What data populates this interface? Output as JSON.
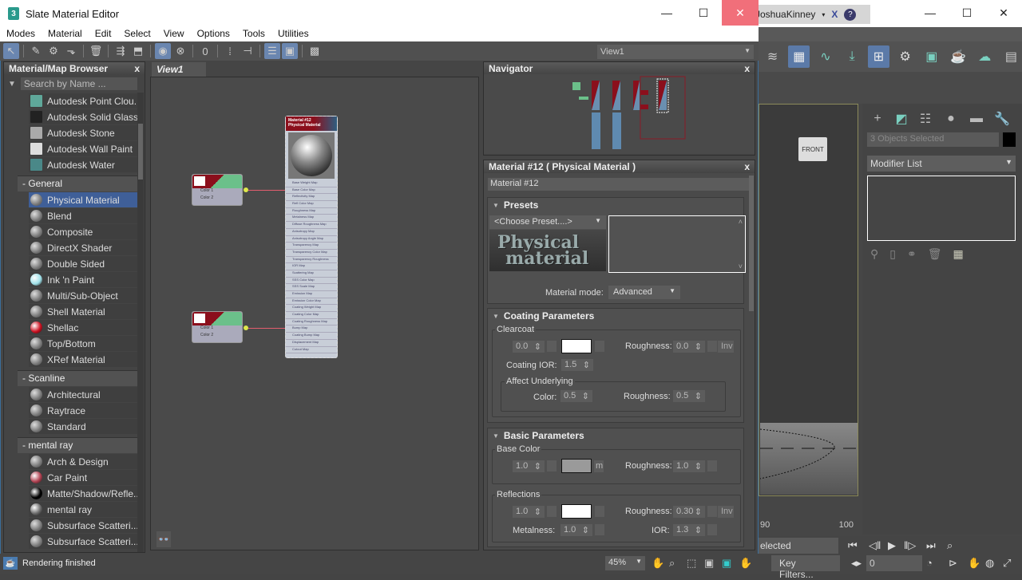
{
  "background_app": {
    "user": "JoshuaKinney",
    "window_controls": [
      "minimize",
      "maximize",
      "close"
    ],
    "viewport_label": "FRONT",
    "command_panel": {
      "objects_selected": "3 Objects Selected",
      "modifier_list": "Modifier List",
      "tabs": [
        "create",
        "modify",
        "hierarchy",
        "motion",
        "display",
        "utilities"
      ]
    },
    "timeline": {
      "ticks": [
        "90",
        "100"
      ]
    },
    "selection_filter": "elected",
    "key_filters": "Key Filters...",
    "frame": "0"
  },
  "sme": {
    "title": "Slate Material Editor",
    "menu": [
      "Modes",
      "Material",
      "Edit",
      "Select",
      "View",
      "Options",
      "Tools",
      "Utilities"
    ],
    "view_select": "View1",
    "browser": {
      "title": "Material/Map Browser",
      "close": "x",
      "search_placeholder": "Search by Name ...",
      "autodesk_items": [
        {
          "label": "Autodesk Point Clou...",
          "swatch": "#5fa89a"
        },
        {
          "label": "Autodesk Solid Glass",
          "swatch": "#222"
        },
        {
          "label": "Autodesk Stone",
          "swatch": "#aaa"
        },
        {
          "label": "Autodesk Wall Paint",
          "swatch": "#ddd"
        },
        {
          "label": "Autodesk Water",
          "swatch": "#4a8888"
        }
      ],
      "groups": [
        {
          "label": "- General",
          "items": [
            {
              "label": "Physical Material",
              "selected": true
            },
            {
              "label": "Blend"
            },
            {
              "label": "Composite"
            },
            {
              "label": "DirectX Shader"
            },
            {
              "label": "Double Sided"
            },
            {
              "label": "Ink 'n Paint",
              "swatch": "#9fe0e8"
            },
            {
              "label": "Multi/Sub-Object"
            },
            {
              "label": "Shell Material"
            },
            {
              "label": "Shellac",
              "swatch": "#cc1020"
            },
            {
              "label": "Top/Bottom"
            },
            {
              "label": "XRef Material"
            }
          ]
        },
        {
          "label": "- Scanline",
          "items": [
            {
              "label": "Architectural"
            },
            {
              "label": "Raytrace"
            },
            {
              "label": "Standard"
            }
          ]
        },
        {
          "label": "- mental ray",
          "items": [
            {
              "label": "Arch & Design"
            },
            {
              "label": "Car Paint",
              "swatch": "#b04050"
            },
            {
              "label": "Matte/Shadow/Refle...",
              "swatch": "#000"
            },
            {
              "label": "mental ray",
              "swatch": "#6a6a6a"
            },
            {
              "label": "Subsurface Scatteri..."
            },
            {
              "label": "Subsurface Scatteri..."
            }
          ]
        }
      ]
    },
    "view": {
      "tab": "View1",
      "small_nodes": [
        {
          "slots": [
            "Color 1",
            "Color 2"
          ]
        },
        {
          "slots": [
            "Color 1",
            "Color 2"
          ]
        }
      ],
      "material_node": {
        "title": "Material #12",
        "subtitle": "Physical Material",
        "slots": [
          "Base Weight Map",
          "Base Color Map",
          "Reflectivity Map",
          "Refl Color Map",
          "Roughness Map",
          "Metalness Map",
          "Diffuse Roughness Map",
          "Anisotropy Map",
          "Anisotropy Angle Map",
          "Transparency Map",
          "Transparency Color Map",
          "Transparency Roughness",
          "IOR Map",
          "Scattering Map",
          "SSS Color Map",
          "SSS Scale Map",
          "Emission Map",
          "Emission Color Map",
          "Coating Weight Map",
          "Coating Color Map",
          "Coating Roughness Map",
          "Bump Map",
          "Coating Bump Map",
          "Displacement Map",
          "Cutout Map"
        ]
      }
    },
    "navigator": {
      "title": "Navigator",
      "close": "x"
    },
    "param_editor": {
      "title": "Material #12  ( Physical Material )",
      "close": "x",
      "name_field": "Material #12",
      "presets": {
        "title": "Presets",
        "choose": "<Choose Preset....>",
        "image_text_1": "Physical",
        "image_text_2": "material",
        "mode_label": "Material mode:",
        "mode_value": "Advanced"
      },
      "coating": {
        "title": "Coating Parameters",
        "clearcoat_label": "Clearcoat",
        "weight": "0.0",
        "roughness_label": "Roughness:",
        "roughness": "0.0",
        "inv": "Inv",
        "ior_label": "Coating IOR:",
        "ior": "1.5",
        "affect_label": "Affect Underlying",
        "color_label": "Color:",
        "color": "0.5",
        "affect_rough_label": "Roughness:",
        "affect_rough": "0.5",
        "swatch": "#ffffff"
      },
      "basic": {
        "title": "Basic Parameters",
        "base_color_label": "Base Color",
        "base_weight": "1.0",
        "base_swatch": "#9a9a9a",
        "m": "m",
        "roughness_label": "Roughness:",
        "roughness": "1.0",
        "reflections_label": "Reflections",
        "refl_weight": "1.0",
        "refl_swatch": "#ffffff",
        "refl_rough_label": "Roughness:",
        "refl_rough": "0.30",
        "inv": "Inv",
        "metal_label": "Metalness:",
        "metal": "1.0",
        "ior_label": "IOR:",
        "ior": "1.3"
      }
    },
    "status": {
      "text": "Rendering finished",
      "zoom": "45%"
    }
  }
}
